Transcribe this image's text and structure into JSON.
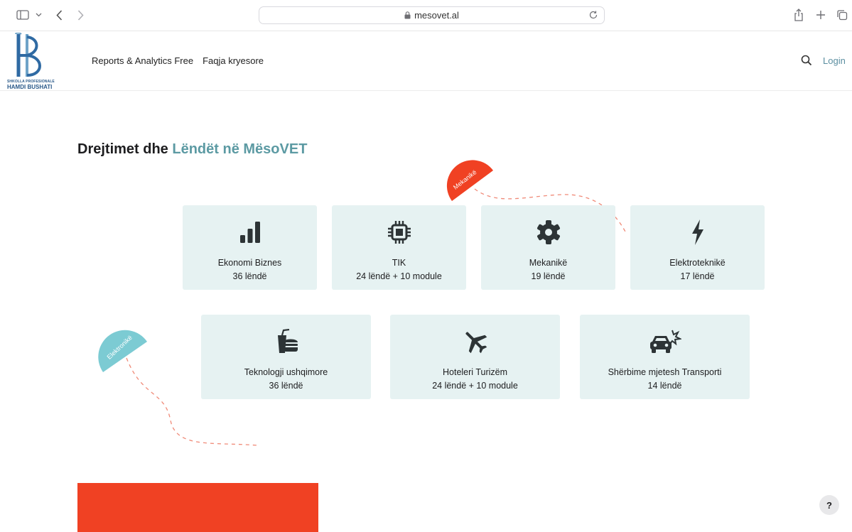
{
  "browser": {
    "url": "mesovet.al"
  },
  "header": {
    "logo_line1": "SHKOLLA PROFESIONALE",
    "logo_line2": "HAMDI BUSHATI",
    "nav": [
      {
        "label": "Reports & Analytics Free"
      },
      {
        "label": "Faqja kryesore"
      }
    ],
    "login_label": "Login"
  },
  "main": {
    "title_plain": "Drejtimet dhe",
    "title_accent": "Lëndët në MësoVET",
    "badge_top": "Mekanikë",
    "badge_left": "Elektronikë",
    "cards_row1": [
      {
        "name": "Ekonomi Biznes",
        "count": "36 lëndë",
        "icon": "bar-chart-icon"
      },
      {
        "name": "TIK",
        "count": "24 lëndë + 10 module",
        "icon": "chip-icon"
      },
      {
        "name": "Mekanikë",
        "count": "19 lëndë",
        "icon": "gear-icon"
      },
      {
        "name": "Elektroteknikë",
        "count": "17 lëndë",
        "icon": "bolt-icon"
      }
    ],
    "cards_row2": [
      {
        "name": "Teknologji ushqimore",
        "count": "36 lëndë",
        "icon": "burger-drink-icon"
      },
      {
        "name": "Hoteleri Turizëm",
        "count": "24 lëndë + 10 module",
        "icon": "airplane-icon"
      },
      {
        "name": "Shërbime mjetesh Transporti",
        "count": "14 lëndë",
        "icon": "car-crash-icon"
      }
    ]
  },
  "help_label": "?",
  "colors": {
    "accent": "#5c9aa3",
    "card_bg": "#e6f2f2",
    "orange": "#f04123",
    "teal_badge": "#7ccbd3"
  }
}
